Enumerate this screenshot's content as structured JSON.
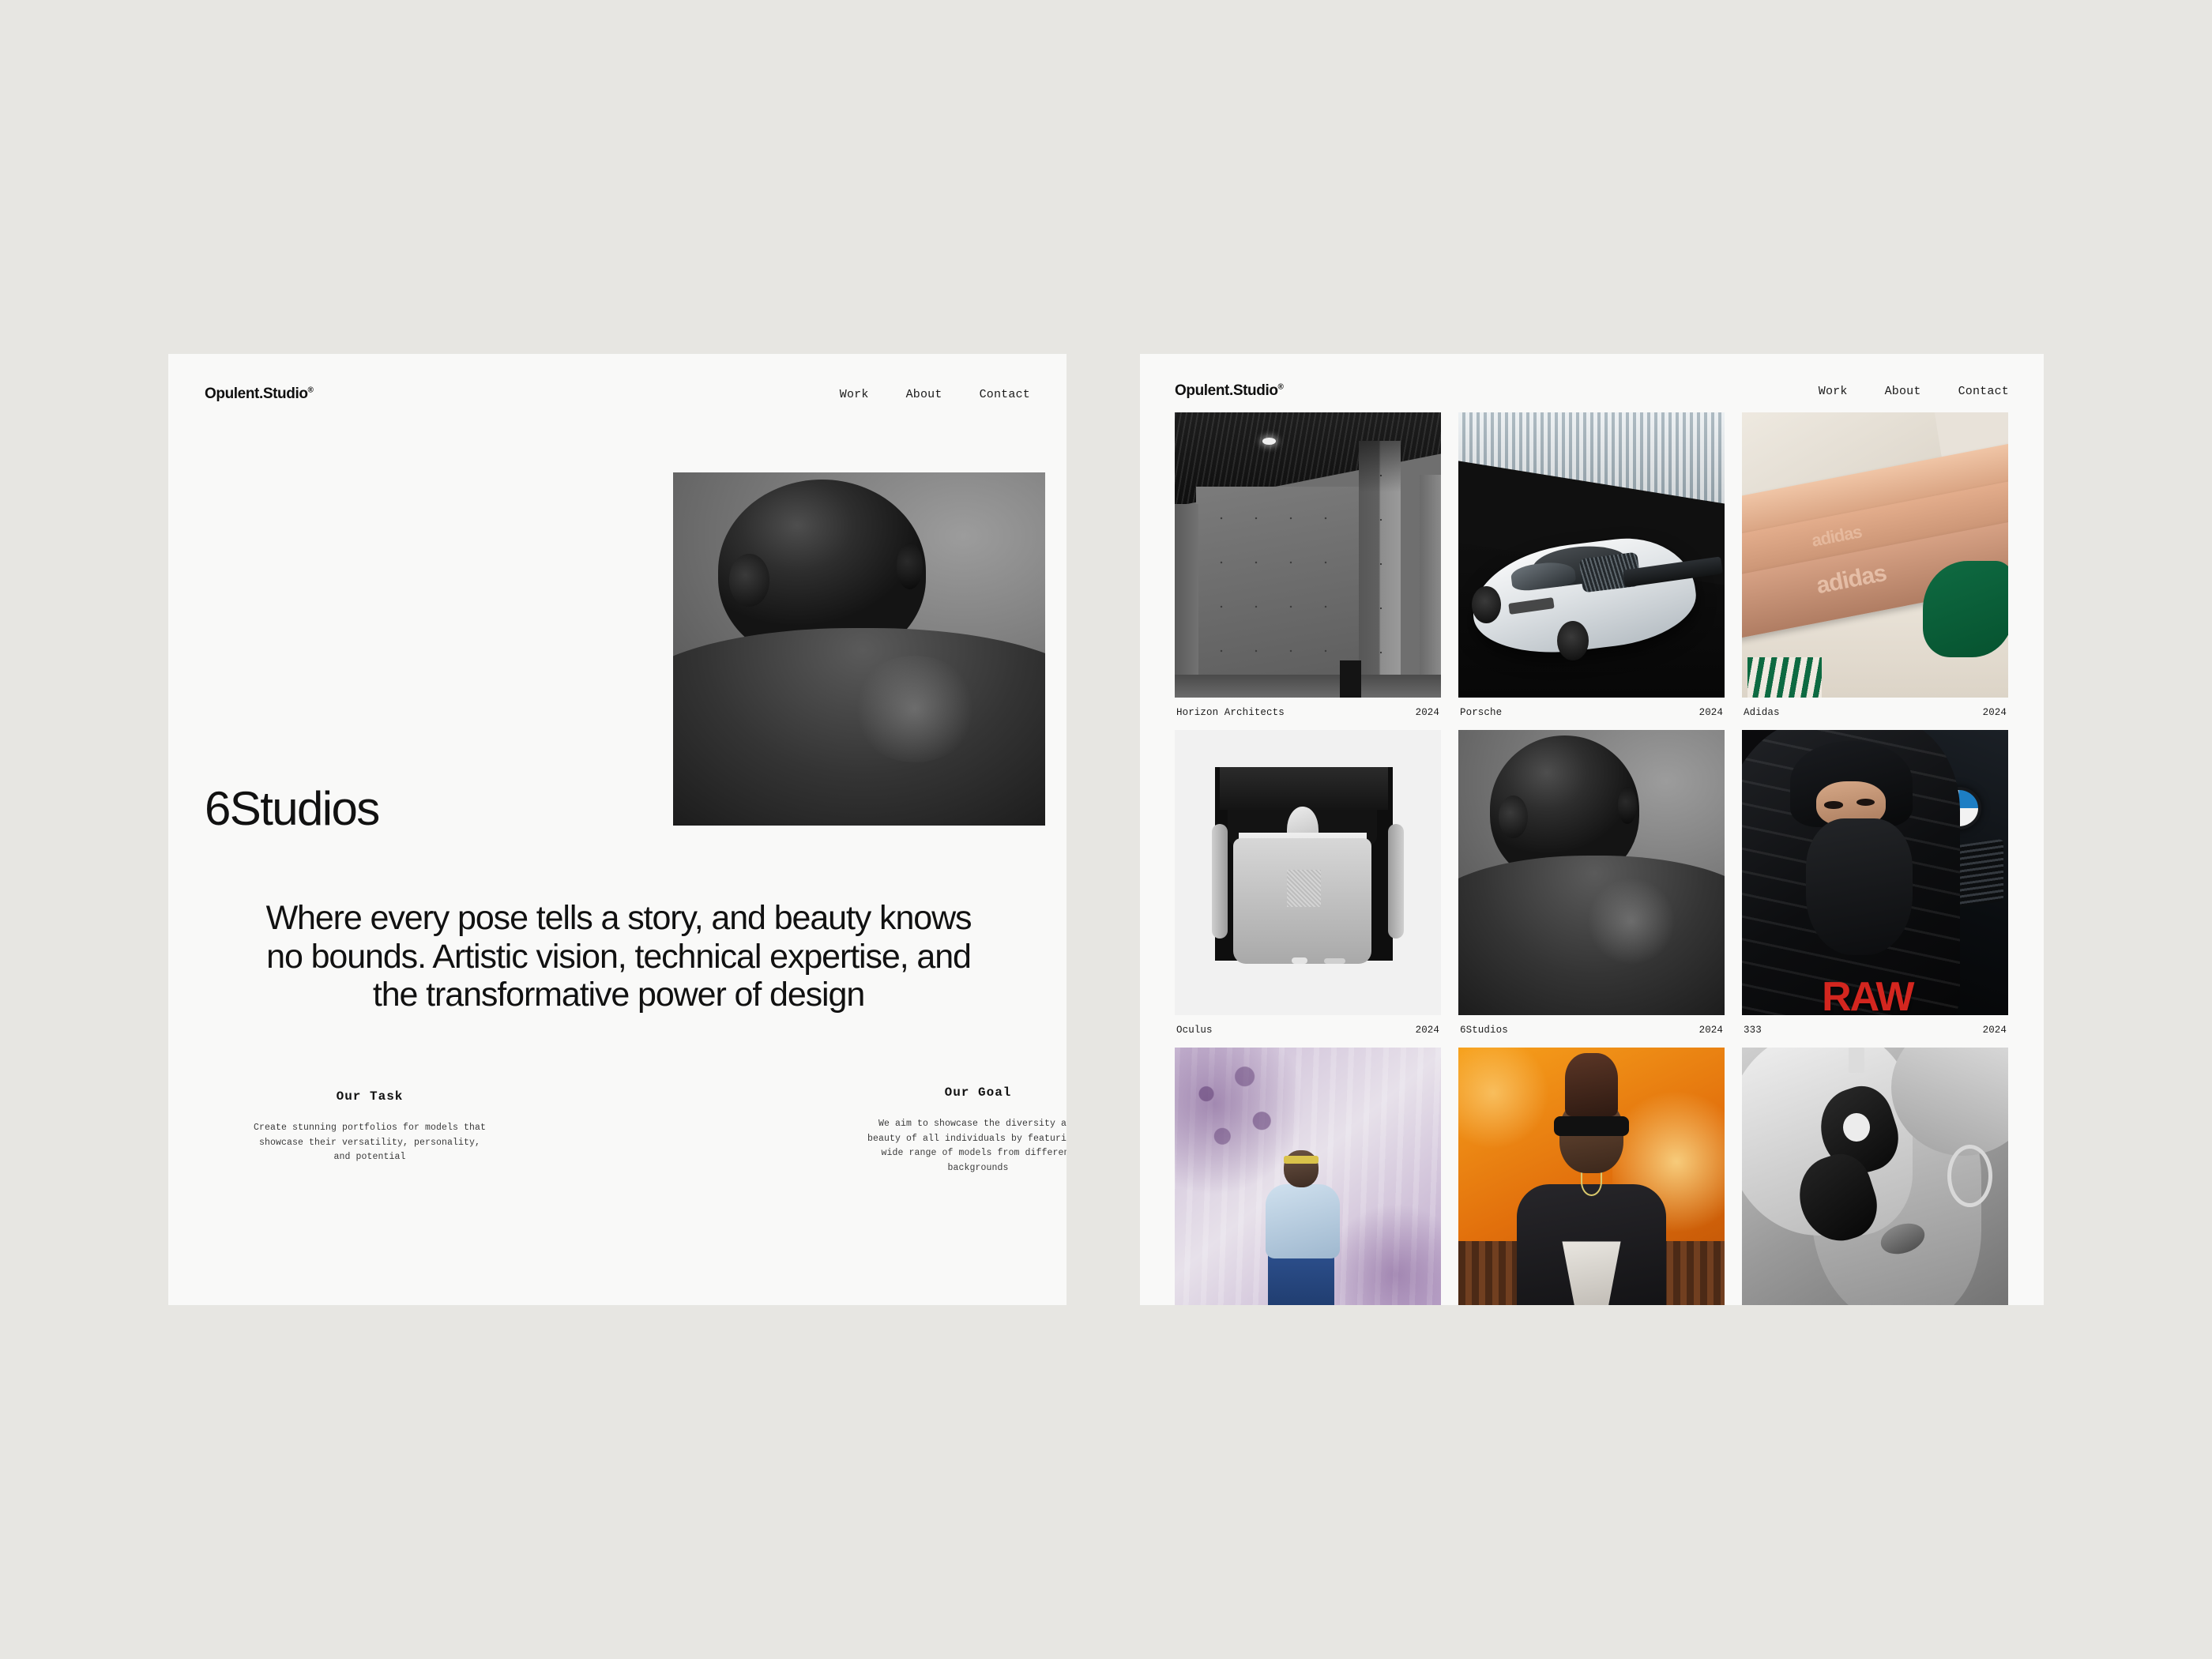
{
  "theme": {
    "page_background": "#e7e6e2",
    "panel_background": "#f9f9f8",
    "text_color": "#111111"
  },
  "left_panel": {
    "header": {
      "logo": "Opulent.Studio",
      "logo_mark": "®",
      "nav": [
        {
          "label": "Work"
        },
        {
          "label": "About"
        },
        {
          "label": "Contact"
        }
      ]
    },
    "hero": {
      "image_alt": "6studios-portrait-photo",
      "title": "6Studios",
      "statement": "Where every pose tells a story, and beauty knows no bounds. Artistic vision, technical expertise, and the transformative power of design"
    },
    "info_columns": [
      {
        "title": "Our Task",
        "body": "Create stunning portfolios for models that showcase their versatility, personality, and potential"
      },
      {
        "title": "Our Goal",
        "body": "We aim to showcase the diversity and beauty of all individuals by featuring a wide range of models from different backgrounds"
      }
    ]
  },
  "right_panel": {
    "header": {
      "logo": "Opulent.Studio",
      "logo_mark": "®",
      "nav": [
        {
          "label": "Work"
        },
        {
          "label": "About"
        },
        {
          "label": "Contact"
        }
      ]
    },
    "work_grid": {
      "rows": [
        [
          {
            "title": "Horizon Architects",
            "year": "2024",
            "image": "concrete-architecture-interior"
          },
          {
            "title": "Porsche",
            "year": "2024",
            "image": "white-sports-car-against-striped-wall"
          },
          {
            "title": "Adidas",
            "year": "2024",
            "image": "sneaker-gum-sole-closeup"
          }
        ],
        [
          {
            "title": "Oculus",
            "year": "2024",
            "image": "vr-headset-in-box"
          },
          {
            "title": "6Studios",
            "year": "2024",
            "image": "back-portrait-black-and-white"
          },
          {
            "title": "333",
            "year": "2024",
            "image": "person-in-black-puffer-with-bmw"
          }
        ],
        [
          {
            "title": "",
            "year": "",
            "image": "purple-shadow-portrait"
          },
          {
            "title": "",
            "year": "",
            "image": "orange-backdrop-portrait"
          },
          {
            "title": "",
            "year": "",
            "image": "black-and-white-sunglasses-portrait"
          }
        ]
      ]
    }
  }
}
